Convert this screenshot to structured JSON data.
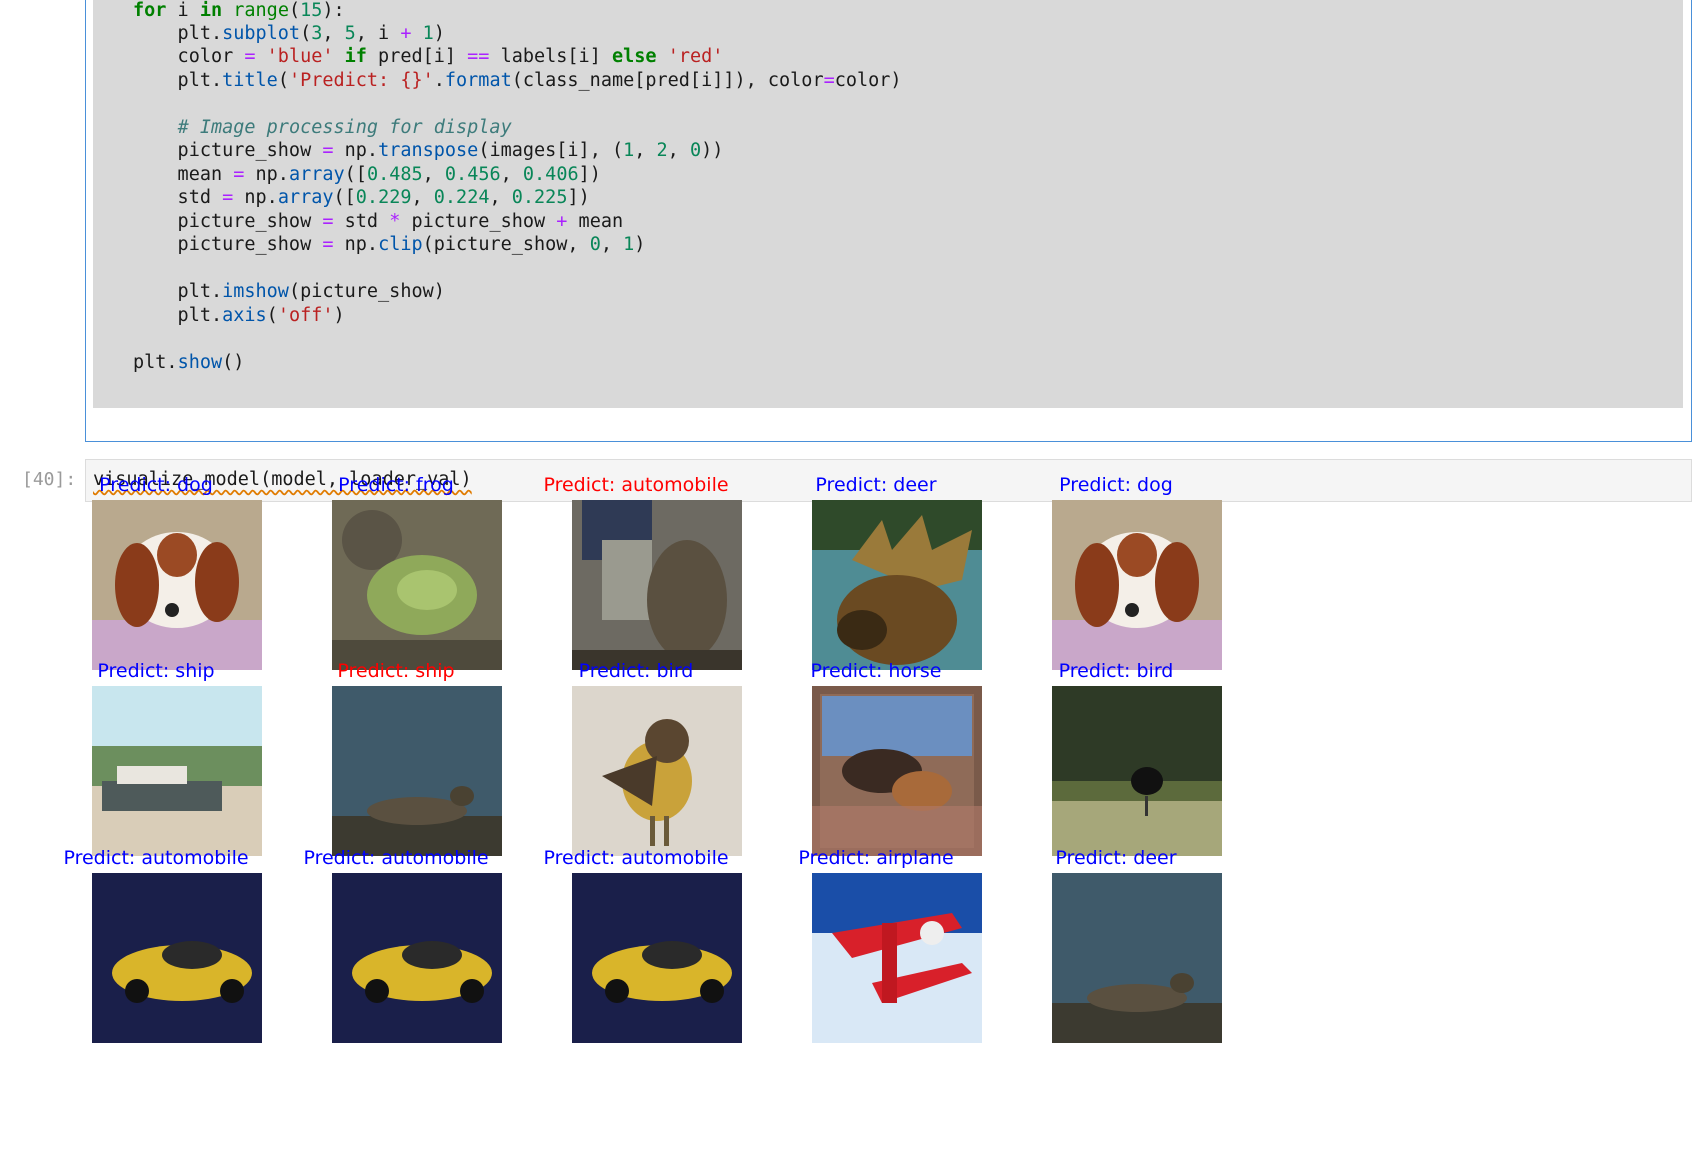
{
  "cell_code": {
    "lines": [
      "for i in range(15):",
      "    plt.subplot(3, 5, i + 1)",
      "    color = 'blue' if pred[i] == labels[i] else 'red'",
      "    plt.title('Predict: {}'.format(class_name[pred[i]]), color=color)",
      "",
      "    # Image processing for display",
      "    picture_show = np.transpose(images[i], (1, 2, 0))",
      "    mean = np.array([0.485, 0.456, 0.406])",
      "    std = np.array([0.229, 0.224, 0.225])",
      "    picture_show = std * picture_show + mean",
      "    picture_show = np.clip(picture_show, 0, 1)",
      "",
      "    plt.imshow(picture_show)",
      "    plt.axis('off')",
      "",
      "plt.show()"
    ]
  },
  "cell_run": {
    "prompt": "[40]:",
    "code": "visualize_model(model, loader_val)"
  },
  "colors": {
    "correct": "#0000ff",
    "incorrect": "#ff0000"
  },
  "predictions": [
    {
      "label": "Predict: dog",
      "correct": true,
      "icon": "dog-photo"
    },
    {
      "label": "Predict: frog",
      "correct": true,
      "icon": "frog-photo"
    },
    {
      "label": "Predict: automobile",
      "correct": false,
      "icon": "cat-photo"
    },
    {
      "label": "Predict: deer",
      "correct": true,
      "icon": "moose-photo"
    },
    {
      "label": "Predict: dog",
      "correct": true,
      "icon": "dog-photo"
    },
    {
      "label": "Predict: ship",
      "correct": true,
      "icon": "ship-photo"
    },
    {
      "label": "Predict: ship",
      "correct": false,
      "icon": "deer-photo"
    },
    {
      "label": "Predict: bird",
      "correct": true,
      "icon": "bird-photo"
    },
    {
      "label": "Predict: horse",
      "correct": true,
      "icon": "horse-photo"
    },
    {
      "label": "Predict: bird",
      "correct": true,
      "icon": "ostrich-photo"
    },
    {
      "label": "Predict: automobile",
      "correct": true,
      "icon": "car-photo"
    },
    {
      "label": "Predict: automobile",
      "correct": true,
      "icon": "car-photo"
    },
    {
      "label": "Predict: automobile",
      "correct": true,
      "icon": "car-photo"
    },
    {
      "label": "Predict: airplane",
      "correct": true,
      "icon": "airplane-photo"
    },
    {
      "label": "Predict: deer",
      "correct": true,
      "icon": "deer-photo"
    }
  ]
}
